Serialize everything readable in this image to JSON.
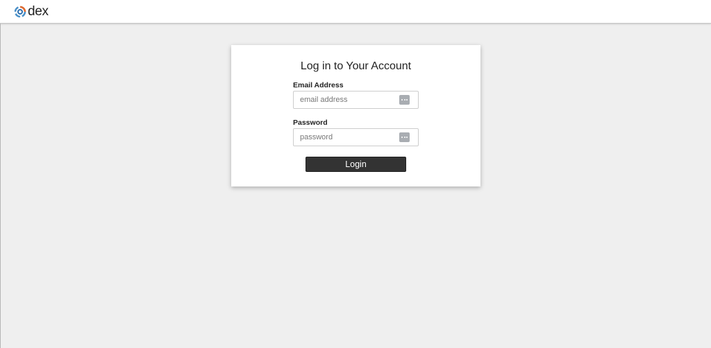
{
  "header": {
    "logo_text": "dex",
    "logo_icon": "dex-logo-icon",
    "logo_colors": [
      "#4a90c8",
      "#e36a2e",
      "#2c6fb0"
    ]
  },
  "login_card": {
    "title": "Log in to Your Account",
    "email": {
      "label": "Email Address",
      "placeholder": "email address",
      "value": "",
      "icon": "password-manager-dots-icon"
    },
    "password": {
      "label": "Password",
      "placeholder": "password",
      "value": "",
      "icon": "password-manager-dots-icon"
    },
    "submit_label": "Login"
  },
  "colors": {
    "page_background": "#efefef",
    "card_background": "#ffffff",
    "button_background": "#333333",
    "button_text": "#ffffff"
  }
}
